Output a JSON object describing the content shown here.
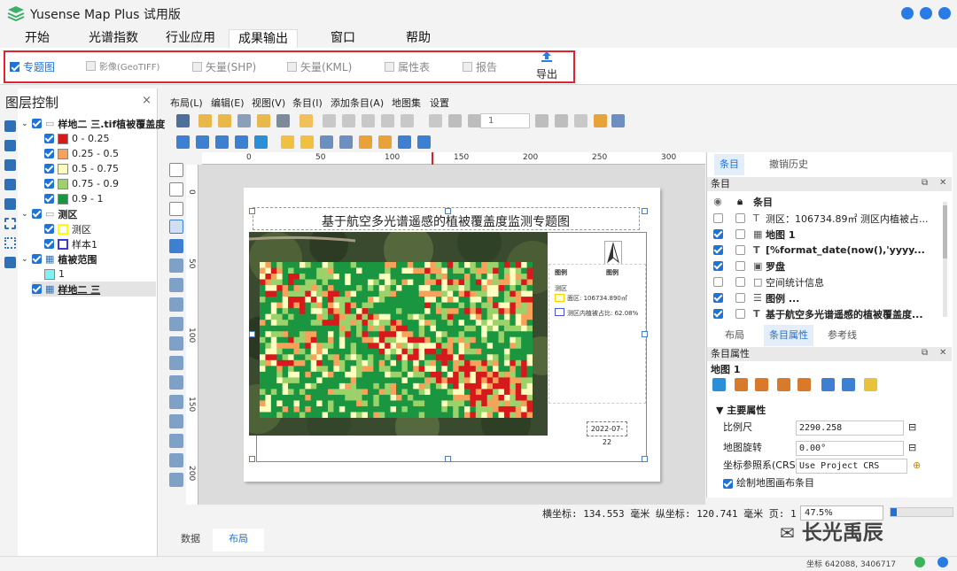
{
  "app": {
    "title": "Yusense Map Plus 试用版",
    "window_controls": [
      "minimize",
      "maximize",
      "close"
    ],
    "control_color": "#2b7be4"
  },
  "menu": {
    "tabs": [
      "开始",
      "光谱指数",
      "行业应用",
      "成果输出",
      "窗口",
      "帮助"
    ],
    "active": "成果输出"
  },
  "ribbon": {
    "options": [
      {
        "label": "专题图",
        "checked": true
      },
      {
        "label": "影像(GeoTIFF)",
        "checked": false
      },
      {
        "label": "矢量(SHP)",
        "checked": false
      },
      {
        "label": "矢量(KML)",
        "checked": false
      },
      {
        "label": "属性表",
        "checked": false
      },
      {
        "label": "报告",
        "checked": false
      }
    ],
    "export_label": "导出",
    "highlight_color": "#e0232e"
  },
  "layer_panel": {
    "title": "图层控制",
    "close": "×",
    "tree": [
      {
        "label": "样地二 三.tif植被覆盖度",
        "bold": true
      },
      {
        "label": "0 - 0.25",
        "color": "#d7191c"
      },
      {
        "label": "0.25 - 0.5",
        "color": "#f8a15b"
      },
      {
        "label": "0.5 - 0.75",
        "color": "#ffffc0"
      },
      {
        "label": "0.75 - 0.9",
        "color": "#9bd26a"
      },
      {
        "label": "0.9 - 1",
        "color": "#1a9641"
      },
      {
        "label": "测区",
        "bold": true
      },
      {
        "label": "测区",
        "color": "#ffff00"
      },
      {
        "label": "样本1",
        "color": "#3a3ad6"
      },
      {
        "label": "植被范围",
        "bold": true
      },
      {
        "label": "1",
        "color": "#7ff3f3"
      },
      {
        "label": "样地二 三",
        "bold": true
      }
    ]
  },
  "layout_menu": [
    "布局(L)",
    "编辑(E)",
    "视图(V)",
    "条目(I)",
    "添加条目(A)",
    "地图集",
    "设置"
  ],
  "page_combo_value": "1",
  "ruler": {
    "h_labels": [
      "0",
      "50",
      "100",
      "150",
      "200",
      "250",
      "300"
    ],
    "v_labels": [
      "0",
      "50",
      "100",
      "150",
      "200"
    ]
  },
  "map": {
    "title": "基于航空多光谱遥感的植被覆盖度监测专题图",
    "date": "2022-07-22",
    "legend": {
      "col1": "图例",
      "col2": "图例",
      "group": "测区",
      "item1": "面区: 106734.890㎡",
      "item2": "测区内植被占比: 62.08%"
    }
  },
  "items_panel": {
    "tabs": [
      "条目",
      "撤销历史"
    ],
    "header": "条目",
    "col_title": "条目",
    "rows": [
      {
        "text": "测区：106734.89㎡ 测区内植被占...",
        "visible": false,
        "type": "T"
      },
      {
        "text": "地图 1",
        "visible": true,
        "bold": true,
        "type": "map"
      },
      {
        "text": "[%format_date(now(),'yyyy...",
        "visible": true,
        "bold": true,
        "type": "T"
      },
      {
        "text": "罗盘",
        "visible": true,
        "bold": true,
        "type": "compass"
      },
      {
        "text": "空间统计信息",
        "visible": false,
        "type": "box"
      },
      {
        "text": "图例                 ...",
        "visible": true,
        "bold": true,
        "type": "legend"
      },
      {
        "text": "基于航空多光谱遥感的植被覆盖度...",
        "visible": true,
        "bold": true,
        "type": "T"
      }
    ]
  },
  "props_panel": {
    "tabs": [
      "布局",
      "条目属性",
      "参考线"
    ],
    "active_tab": "条目属性",
    "header": "条目属性",
    "subheader": "地图 1",
    "section": "主要属性",
    "scale_label": "比例尺",
    "scale_value": "2290.258",
    "rotation_label": "地图旋转",
    "rotation_value": "0.00°",
    "crs_label": "坐标参照系(CRS)",
    "crs_value": "Use Project CRS",
    "draw_label": "绘制地图画布条目",
    "draw_checked": true
  },
  "status": {
    "coords": "横坐标: 134.553 毫米 纵坐标: 120.741 毫米 页: 1",
    "zoom": "47.5%",
    "bottom_tabs": [
      "数据",
      "布局"
    ],
    "active_bottom_tab": "布局",
    "footer_coord": "坐标  642088, 3406717"
  },
  "watermark": "长光禹辰",
  "heatmap_cells": {
    "cols": 48,
    "rows": 27,
    "palette": [
      "#d7191c",
      "#f8a15b",
      "#ffffc0",
      "#9bd26a",
      "#1a9641"
    ]
  }
}
